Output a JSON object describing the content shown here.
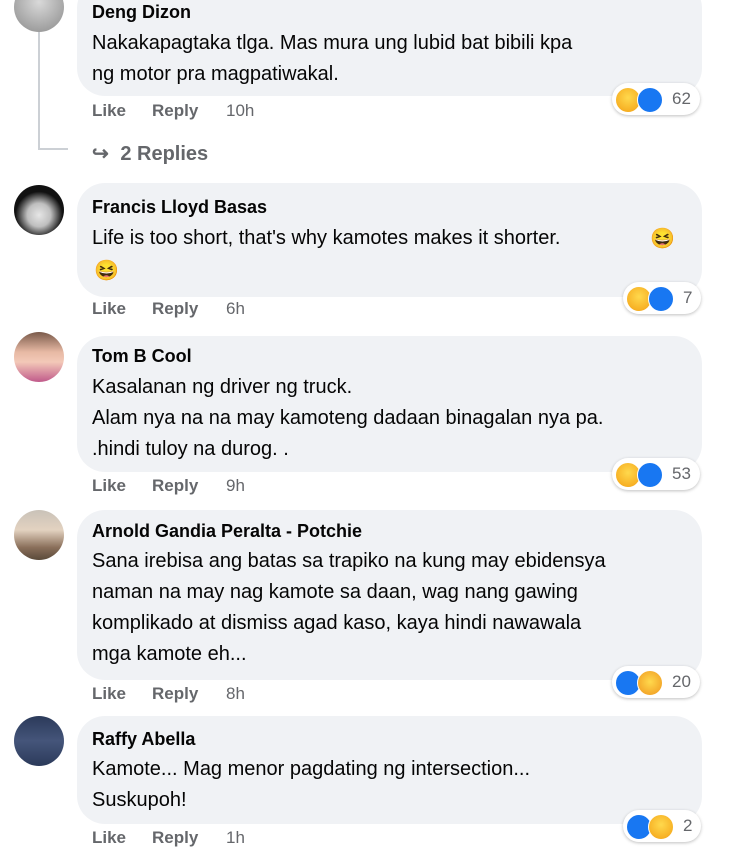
{
  "ui": {
    "like_label": "Like",
    "reply_label": "Reply",
    "reply_arrow": "↪",
    "smile_emoji": "😆"
  },
  "thread_replies": "2 Replies",
  "comments": [
    {
      "author": "Deng Dizon",
      "lines": [
        "Nakakapagtaka tlga. Mas mura ung lubid bat bibili kpa",
        "ng motor pra magpatiwakal."
      ],
      "time": "10h",
      "reactions": [
        "haha-icon",
        "like-icon"
      ],
      "reaction_count": "62"
    },
    {
      "author": "Francis Lloyd Basas",
      "lines": [
        "Life is too short, that's why kamotes makes it shorter."
      ],
      "time": "6h",
      "reactions": [
        "haha-icon",
        "like-icon"
      ],
      "reaction_count": "7"
    },
    {
      "author": "Tom B Cool",
      "lines": [
        "Kasalanan ng driver ng truck.",
        "Alam nya na na may kamoteng dadaan binagalan nya pa.",
        ".hindi tuloy na durog. ."
      ],
      "time": "9h",
      "reactions": [
        "haha-icon",
        "like-icon"
      ],
      "reaction_count": "53"
    },
    {
      "author": "Arnold Gandia Peralta - Potchie",
      "lines": [
        "Sana irebisa ang batas sa trapiko na kung may ebidensya",
        "naman na may nag kamote sa daan, wag nang gawing",
        "komplikado at dismiss agad kaso, kaya hindi nawawala",
        "mga kamote eh..."
      ],
      "time": "8h",
      "reactions": [
        "like-icon",
        "care-icon"
      ],
      "reaction_count": "20"
    },
    {
      "author": "Raffy Abella",
      "lines": [
        "Kamote... Mag menor pagdating ng intersection...",
        "Suskupoh!"
      ],
      "time": "1h",
      "reactions": [
        "like-icon",
        "haha-icon"
      ],
      "reaction_count": "2"
    }
  ]
}
